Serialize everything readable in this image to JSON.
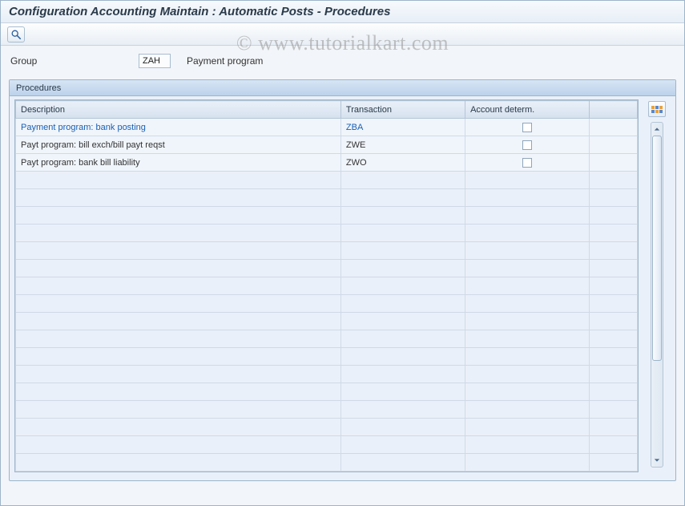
{
  "title": "Configuration Accounting Maintain : Automatic Posts - Procedures",
  "watermark": "© www.tutorialkart.com",
  "header": {
    "group_label": "Group",
    "group_value": "ZAH",
    "group_desc": "Payment program"
  },
  "panel": {
    "title": "Procedures"
  },
  "columns": {
    "description": "Description",
    "transaction": "Transaction",
    "account_determ": "Account determ."
  },
  "rows": [
    {
      "desc": "Payment program: bank posting",
      "trans": "ZBA",
      "acct": false,
      "selected": true
    },
    {
      "desc": "Payt program: bill exch/bill payt reqst",
      "trans": "ZWE",
      "acct": false,
      "selected": false
    },
    {
      "desc": "Payt program: bank bill liability",
      "trans": "ZWO",
      "acct": false,
      "selected": false
    }
  ],
  "icons": {
    "search": "search-icon",
    "config": "table-settings-icon",
    "scroll_up": "scroll-up-icon",
    "scroll_down": "scroll-down-icon"
  },
  "empty_rows": 17
}
